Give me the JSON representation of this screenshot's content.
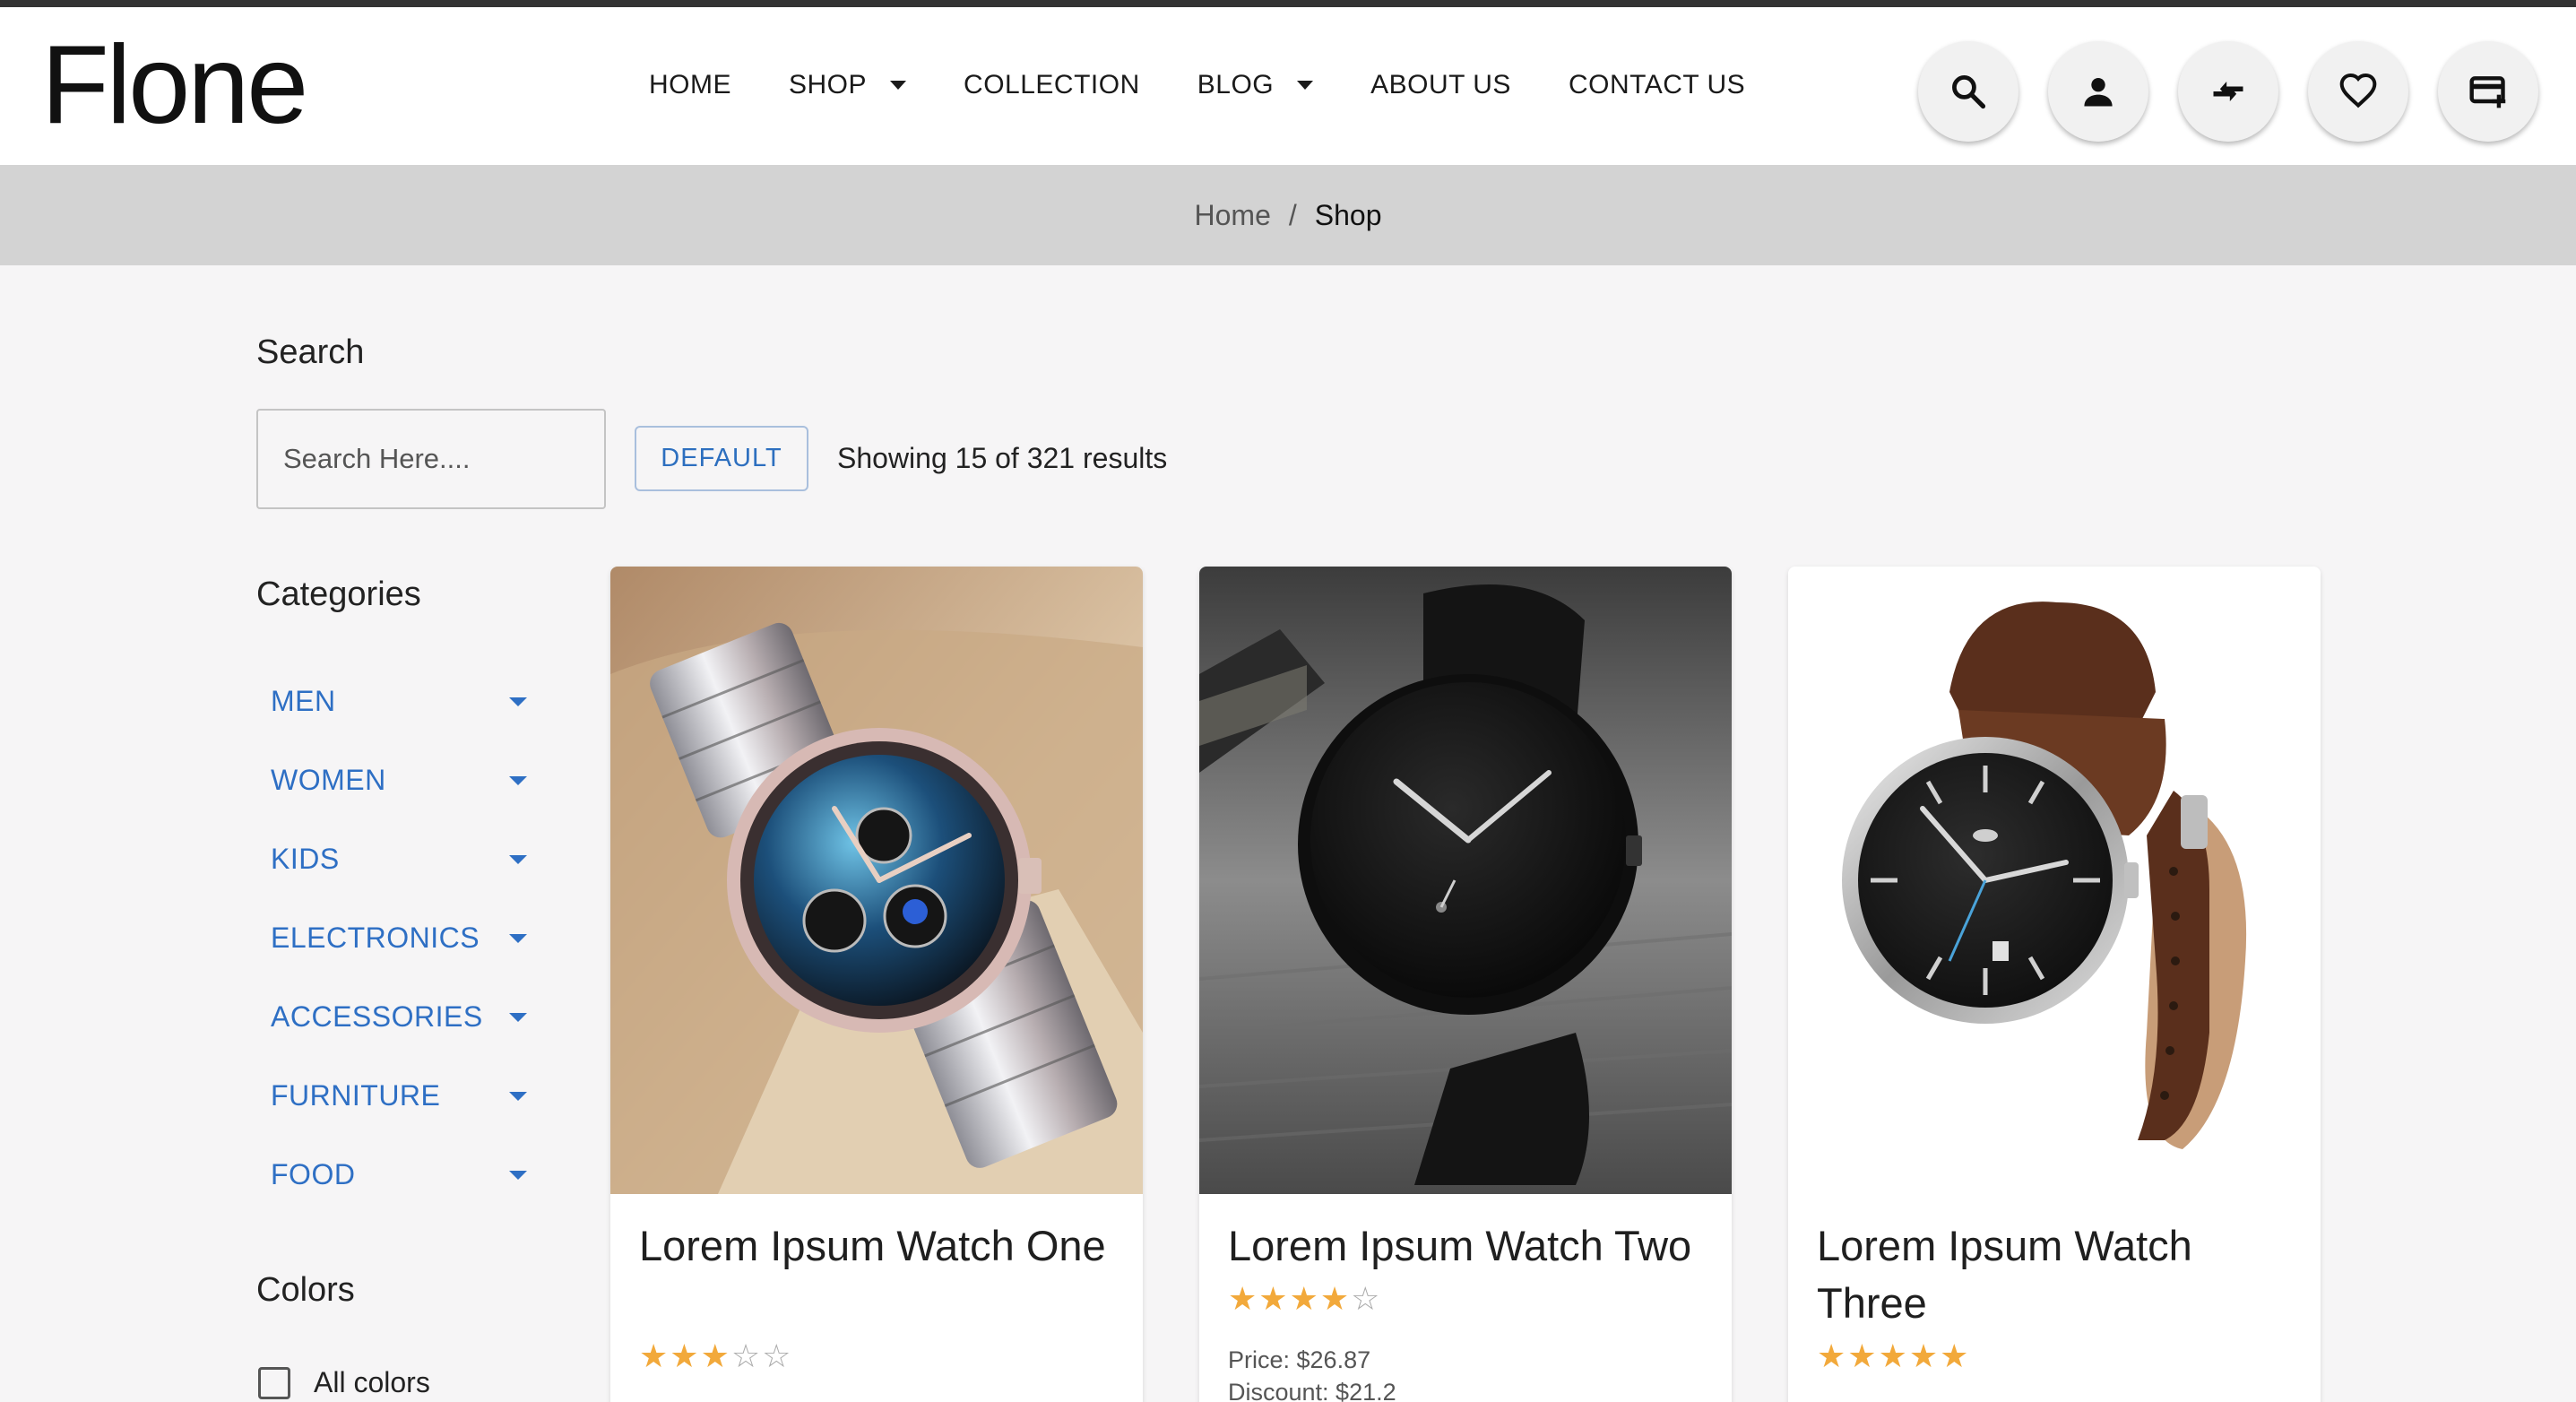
{
  "brand": {
    "logo": "Flone"
  },
  "nav": [
    {
      "label": "HOME",
      "dropdown": false
    },
    {
      "label": "SHOP",
      "dropdown": true
    },
    {
      "label": "COLLECTION",
      "dropdown": false
    },
    {
      "label": "BLOG",
      "dropdown": true
    },
    {
      "label": "ABOUT US",
      "dropdown": false
    },
    {
      "label": "CONTACT US",
      "dropdown": false
    }
  ],
  "header_icons": [
    "search-icon",
    "user-icon",
    "compare-icon",
    "heart-icon",
    "cart-icon"
  ],
  "breadcrumb": {
    "home": "Home",
    "separator": "/",
    "current": "Shop"
  },
  "search": {
    "title": "Search",
    "placeholder": "Search Here....",
    "value": "",
    "sort_label": "DEFAULT",
    "results_text": "Showing 15 of 321 results"
  },
  "categories": {
    "title": "Categories",
    "items": [
      "MEN",
      "WOMEN",
      "KIDS",
      "ELECTRONICS",
      "ACCESSORIES",
      "FURNITURE",
      "FOOD"
    ]
  },
  "colors": {
    "title": "Colors",
    "options": [
      {
        "label": "All colors",
        "checked": false
      }
    ]
  },
  "products": [
    {
      "title": "Lorem Ipsum Watch One",
      "rating": 3,
      "rating_max": 5
    },
    {
      "title": "Lorem Ipsum Watch Two",
      "rating": 4,
      "rating_max": 5,
      "price": "Price: $26.87",
      "discount": "Discount: $21.2"
    },
    {
      "title": "Lorem Ipsum Watch Three",
      "rating": 5,
      "rating_max": 5
    }
  ],
  "theme": {
    "link_blue": "#2e6fc4",
    "star": "#f2a93b",
    "breadcrumb_bg": "#d3d3d3"
  }
}
